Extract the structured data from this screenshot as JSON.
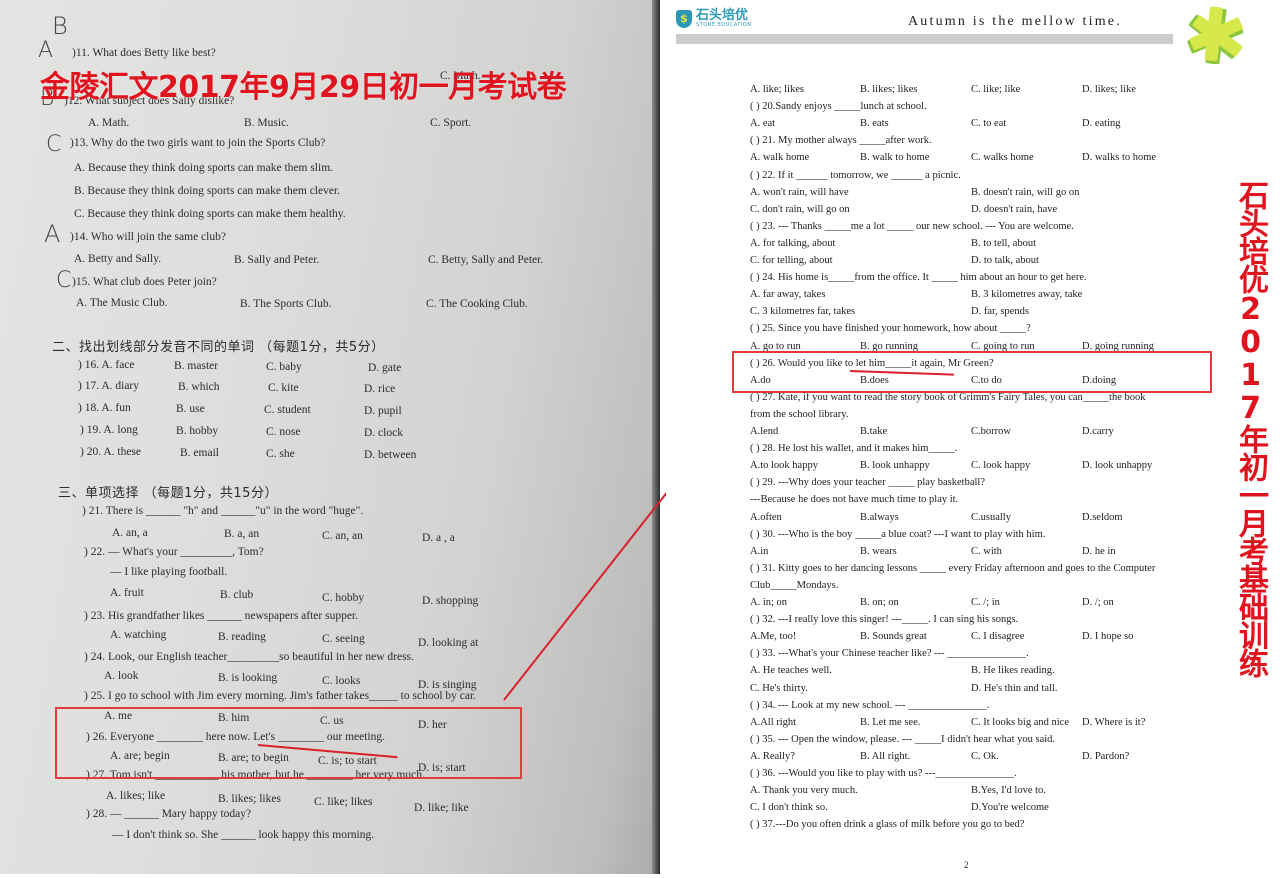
{
  "photo_page": {
    "overlay_title": "金陵汇文2017年9月29日初一月考试卷",
    "handwritten_marks": [
      "B",
      "A",
      "B",
      "C",
      "A",
      "C"
    ],
    "questions_listening": [
      {
        "stem": ")11. What does Betty like best?",
        "options": [
          "",
          "",
          "C. Math."
        ]
      },
      {
        "stem": ")12. What subject does Sally dislike?",
        "options": [
          "A. Math.",
          "B. Music.",
          "C. Sport."
        ]
      },
      {
        "stem": ")13. Why do the two girls want to join the Sports Club?",
        "options": [
          "A. Because they think doing sports can make them slim.",
          "B. Because they think doing sports can make them clever.",
          "C. Because they think doing sports can make them healthy."
        ]
      },
      {
        "stem": ")14. Who will join the same club?",
        "options": [
          "A. Betty and Sally.",
          "B. Sally and Peter.",
          "C. Betty, Sally and Peter."
        ]
      },
      {
        "stem": ")15. What club does Peter join?",
        "options": [
          "A. The Music Club.",
          "B. The Sports Club.",
          "C. The Cooking Club."
        ]
      }
    ],
    "section2_heading": "二、找出划线部分发音不同的单词 （每题1分，共5分）",
    "section2_rows": [
      {
        "num": ") 16. A. face",
        "b": "B. master",
        "c": "C. baby",
        "d": "D. gate"
      },
      {
        "num": ") 17. A. diary",
        "b": "B. which",
        "c": "C. kite",
        "d": "D. rice"
      },
      {
        "num": ") 18. A. fun",
        "b": "B. use",
        "c": "C. student",
        "d": "D. pupil"
      },
      {
        "num": ") 19. A. long",
        "b": "B. hobby",
        "c": "C. nose",
        "d": "D. clock"
      },
      {
        "num": ") 20. A. these",
        "b": "B. email",
        "c": "C. she",
        "d": "D. between"
      }
    ],
    "section3_heading": "三、单项选择 （每题1分，共15分）",
    "section3_items": [
      {
        "stem": ") 21. There is ______ \"h\" and ______\"u\" in the word \"huge\".",
        "options": [
          "A. an, a",
          "B. a, an",
          "C. an, an",
          "D. a , a"
        ]
      },
      {
        "stem": ") 22. — What's your _________, Tom?",
        "sub": "— I like playing football.",
        "options": [
          "A. fruit",
          "B. club",
          "C. hobby",
          "D. shopping"
        ]
      },
      {
        "stem": ") 23. His grandfather likes ______ newspapers after supper.",
        "options": [
          "A. watching",
          "B. reading",
          "C. seeing",
          "D. looking at"
        ]
      },
      {
        "stem": ") 24. Look, our English teacher_________so beautiful in her new dress.",
        "options": [
          "A. look",
          "B. is looking",
          "C. looks",
          "D. is singing"
        ]
      },
      {
        "stem": ") 25. I go to school with Jim every morning. Jim's father takes_____ to school by car.",
        "options": [
          "A. me",
          "B. him",
          "C. us",
          "D. her"
        ]
      },
      {
        "stem": ") 26. Everyone ________ here now. Let's ________ our meeting.",
        "options": [
          "A. are; begin",
          "B. are; to begin",
          "C. is; to start",
          "D. is; start"
        ]
      },
      {
        "stem": ") 27. Tom isn't ___________ his mother, but he ________ her very much.",
        "options": [
          "A. likes; like",
          "B. likes; likes",
          "C. like; likes",
          "D. like; like"
        ]
      },
      {
        "stem": ") 28. — ______ Mary happy today?",
        "sub": "— I don't think so. She ______ look happy this morning.",
        "options": []
      }
    ]
  },
  "scan_page": {
    "brand_name": "石头培优",
    "brand_sub": "STONE EDUCATION",
    "brand_icon": "shield-dollar-icon",
    "motto": "Autumn is the mellow time.",
    "vertical_title": "石头培优2017年初一月考基础训练",
    "page_number": "2",
    "lines": [
      {
        "cols": [
          "A. like; likes",
          "B. likes; likes",
          "C. like; like",
          "D. likes; like"
        ]
      },
      {
        "text": "(      ) 20.Sandy enjoys _____lunch at school."
      },
      {
        "cols": [
          "A. eat",
          "B. eats",
          "C. to eat",
          "D. eating"
        ]
      },
      {
        "text": "(      ) 21. My mother always _____after work."
      },
      {
        "cols": [
          "A. walk home",
          "B. walk to home",
          "C. walks home",
          "D. walks to home"
        ]
      },
      {
        "text": "(      ) 22. If it ______ tomorrow, we ______ a picnic."
      },
      {
        "half": [
          "A. won't rain, will have",
          "B. doesn't rain, will go on"
        ]
      },
      {
        "half": [
          "C. don't rain, will go on",
          "D. doesn't rain, have"
        ]
      },
      {
        "text": "(      ) 23. --- Thanks _____me a lot _____ our new school. --- You are welcome."
      },
      {
        "half": [
          "A. for talking, about",
          "B. to tell, about"
        ]
      },
      {
        "half": [
          "C. for telling, about",
          "D. to talk, about"
        ]
      },
      {
        "text": "(      ) 24. His home is_____from the office. It _____ him about an hour to get here."
      },
      {
        "half": [
          "A. far away, takes",
          "B. 3 kilometres away, take"
        ]
      },
      {
        "half": [
          "C. 3 kilometres far, takes",
          "D. far, spends"
        ]
      },
      {
        "text": "(       ) 25. Since you have finished your homework, how about _____?"
      },
      {
        "cols": [
          "A. go to run",
          "B. go running",
          "C. going to run",
          "D. going running"
        ]
      },
      {
        "text": "(       ) 26. Would you like to let him_____it again, Mr Green?"
      },
      {
        "cols": [
          "A.do",
          "B.does",
          "C.to do",
          "D.doing"
        ]
      },
      {
        "text": "(       ) 27. Kate, if you want to read the story book of Grimm's Fairy Tales, you can_____the book"
      },
      {
        "text": "from the school library."
      },
      {
        "cols": [
          "A.lend",
          "B.take",
          "C.borrow",
          "D.carry"
        ]
      },
      {
        "text": "(      ) 28. He lost his wallet, and it makes him_____."
      },
      {
        "cols": [
          "A.to look happy",
          "B. look unhappy",
          "C. look happy",
          "D. look unhappy"
        ]
      },
      {
        "text": "(       ) 29. ---Why does your teacher _____ play basketball?"
      },
      {
        "text": "                  ---Because he does not have much time to play it."
      },
      {
        "cols": [
          "A.often",
          "B.always",
          "C.usually",
          "D.seldom"
        ]
      },
      {
        "text": "(       ) 30. ---Who is the boy _____a blue coat?     ---I want to play with him."
      },
      {
        "cols": [
          "A.in",
          "B. wears",
          "C. with",
          "D. he in"
        ]
      },
      {
        "text": "(      ) 31. Kitty goes to her dancing lessons _____ every Friday afternoon and goes to the Computer"
      },
      {
        "text": "Club_____Mondays."
      },
      {
        "cols": [
          "A. in; on",
          "B. on; on",
          "C. /; in",
          "D. /; on"
        ]
      },
      {
        "text": "(      ) 32. ---I really love this singer!                    ---_____. I can sing his songs."
      },
      {
        "cols": [
          "A.Me, too!",
          "B. Sounds great",
          "C. I disagree",
          "D. I hope so"
        ]
      },
      {
        "text": "(      ) 33. ---What's your Chinese teacher like?     ---  _______________."
      },
      {
        "half": [
          "A.  He teaches well.",
          "B. He likes reading."
        ]
      },
      {
        "half": [
          "C. He's thirty.",
          "D. He's thin and tall."
        ]
      },
      {
        "text": "(      ) 34. --- Look at my new school.                   ---  _______________."
      },
      {
        "cols": [
          "A.All right",
          "B. Let me see.",
          "C. It looks big and nice",
          "D. Where is it?"
        ]
      },
      {
        "text": "(      ) 35. --- Open the window, please.                  --- _____I didn't hear what you said."
      },
      {
        "cols": [
          "A. Really?",
          "B. All right.",
          "C. Ok.",
          "D. Pardon?"
        ]
      },
      {
        "text": "(      ) 36. ---Would you like to play with us?           ---_______________."
      },
      {
        "half": [
          "A. Thank you very much.",
          "B.Yes, I'd love to."
        ]
      },
      {
        "half": [
          "C. I don't think so.",
          "D.You're welcome"
        ]
      },
      {
        "text": "(      ) 37.---Do you often drink a glass of milk before you go to bed?"
      }
    ]
  },
  "annotation": {
    "highlight_color": "#e23b3f",
    "linked_question_photo": "26",
    "linked_question_scan": "26"
  }
}
